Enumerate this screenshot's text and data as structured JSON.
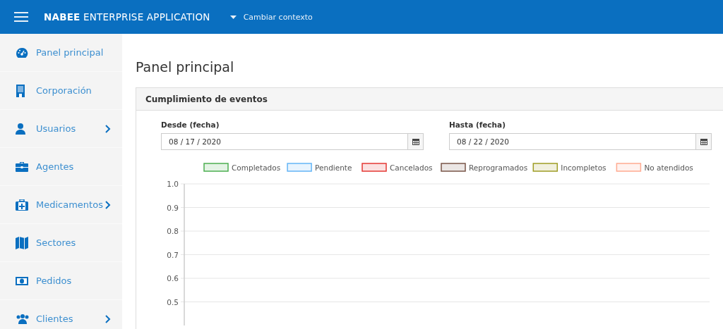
{
  "header": {
    "brand_bold": "NABEE",
    "brand_rest": "ENTERPRISE APPLICATION",
    "context_menu": "Cambiar contexto"
  },
  "sidebar": {
    "items": [
      {
        "label": "Panel principal",
        "has_submenu": false
      },
      {
        "label": "Corporación",
        "has_submenu": false
      },
      {
        "label": "Usuarios",
        "has_submenu": true
      },
      {
        "label": "Agentes",
        "has_submenu": false
      },
      {
        "label": "Medicamentos",
        "has_submenu": true
      },
      {
        "label": "Sectores",
        "has_submenu": false
      },
      {
        "label": "Pedidos",
        "has_submenu": false
      },
      {
        "label": "Clientes",
        "has_submenu": true
      }
    ]
  },
  "page_title": "Panel principal",
  "card": {
    "title": "Cumplimiento de eventos",
    "fields": [
      {
        "label": "Desde (fecha)",
        "value": "08 / 17 / 2020"
      },
      {
        "label": "Hasta (fecha)",
        "value": "08 / 22 / 2020"
      }
    ],
    "chart_data": {
      "type": "bar",
      "grid": true,
      "ylim": [
        0.4,
        1
      ],
      "series": [
        {
          "name": "Completados",
          "color": "#4caf50"
        },
        {
          "name": "Pendiente",
          "color": "#64b5f6"
        },
        {
          "name": "Cancelados",
          "color": "#e53935"
        },
        {
          "name": "Reprogramados",
          "color": "#795548"
        },
        {
          "name": "Incompletos",
          "color": "#9e9d24"
        },
        {
          "name": "No atendidos",
          "color": "#ffab91"
        }
      ],
      "yticks": [
        {
          "value": 1,
          "label": "1.0"
        },
        {
          "value": 0.9,
          "label": "0.9"
        },
        {
          "value": 0.8,
          "label": "0.8"
        },
        {
          "value": 0.7,
          "label": "0.7"
        },
        {
          "value": 0.6,
          "label": "0.6"
        },
        {
          "value": 0.5,
          "label": "0.5"
        }
      ]
    }
  }
}
